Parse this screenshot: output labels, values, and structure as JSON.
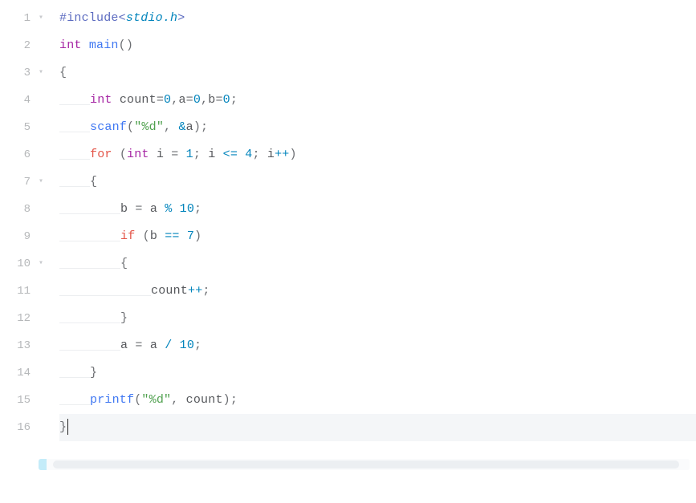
{
  "gutter": {
    "lines": [
      "1",
      "2",
      "3",
      "4",
      "5",
      "6",
      "7",
      "8",
      "9",
      "10",
      "11",
      "12",
      "13",
      "14",
      "15",
      "16"
    ],
    "fold_glyph": "▾",
    "fold_on": [
      1,
      3,
      7,
      10
    ]
  },
  "code": {
    "l1": {
      "pre": "#include",
      "lt": "<",
      "hdr": "stdio.h",
      "gt": ">"
    },
    "l2": {
      "ty": "int",
      "sp": " ",
      "fn": "main",
      "lp": "(",
      "rp": ")"
    },
    "l3": {
      "br": "{"
    },
    "l4": {
      "ty": "int",
      "sp": " ",
      "a": "count",
      "eq1": "=",
      "z1": "0",
      "c1": ",",
      "b": "a",
      "eq2": "=",
      "z2": "0",
      "c2": ",",
      "c": "b",
      "eq3": "=",
      "z3": "0",
      "sc": ";"
    },
    "l5": {
      "fn": "scanf",
      "lp": "(",
      "s": "\"%d\"",
      "cm": ",",
      "sp": " ",
      "amp": "&",
      "id": "a",
      "rp": ")",
      "sc": ";"
    },
    "l6": {
      "kw": "for",
      "sp": " ",
      "lp": "(",
      "ty": "int",
      "sp2": " ",
      "i": "i",
      "sp3": " ",
      "eq": "=",
      "sp4": " ",
      "n1": "1",
      "sc1": ";",
      "sp5": " ",
      "i2": "i",
      "sp6": " ",
      "le": "<=",
      "sp7": " ",
      "n2": "4",
      "sc2": ";",
      "sp8": " ",
      "i3": "i",
      "pp": "++",
      "rp": ")"
    },
    "l7": {
      "br": "{"
    },
    "l8": {
      "b": "b",
      "sp1": " ",
      "eq": "=",
      "sp2": " ",
      "a": "a",
      "sp3": " ",
      "mod": "%",
      "sp4": " ",
      "n": "10",
      "sc": ";"
    },
    "l9": {
      "kw": "if",
      "sp": " ",
      "lp": "(",
      "b": "b",
      "sp2": " ",
      "ee": "==",
      "sp3": " ",
      "n": "7",
      "rp": ")"
    },
    "l10": {
      "br": "{"
    },
    "l11": {
      "id": "count",
      "pp": "++",
      "sc": ";"
    },
    "l12": {
      "br": "}"
    },
    "l13": {
      "a": "a",
      "sp1": " ",
      "eq": "=",
      "sp2": " ",
      "a2": "a",
      "sp3": " ",
      "div": "/",
      "sp4": " ",
      "n": "10",
      "sc": ";"
    },
    "l14": {
      "br": "}"
    },
    "l15": {
      "fn": "printf",
      "lp": "(",
      "s": "\"%d\"",
      "cm": ",",
      "sp": " ",
      "id": "count",
      "rp": ")",
      "sc": ";"
    },
    "l16": {
      "br": "}"
    }
  }
}
